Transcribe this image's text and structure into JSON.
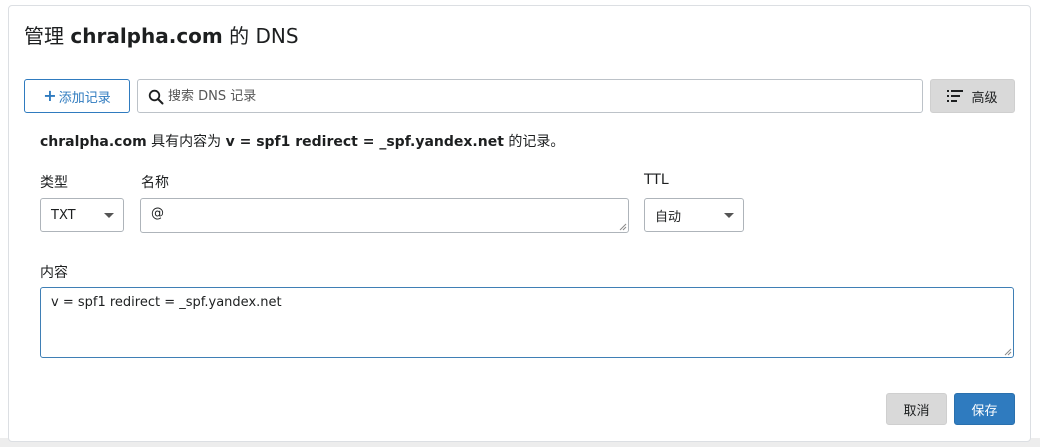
{
  "header": {
    "title_prefix": "管理",
    "domain": "chralpha.com",
    "title_suffix": "的 DNS"
  },
  "toolbar": {
    "add_label": "添加记录",
    "search_placeholder": "搜索 DNS 记录",
    "advanced_label": "高级"
  },
  "summary": {
    "domain": "chralpha.com",
    "text_mid": "具有内容为",
    "content": "v = spf1 redirect = _spf.yandex.net",
    "text_end": "的记录。"
  },
  "form": {
    "type": {
      "label": "类型",
      "value": "TXT"
    },
    "name": {
      "label": "名称",
      "value": "@"
    },
    "ttl": {
      "label": "TTL",
      "value": "自动"
    },
    "content": {
      "label": "内容",
      "value": "v = spf1 redirect = _spf.yandex.net"
    }
  },
  "actions": {
    "cancel_label": "取消",
    "save_label": "保存"
  },
  "colors": {
    "accent": "#2f7bbf",
    "secondary_button": "#d9d9d9",
    "border": "#aeb4ba"
  }
}
